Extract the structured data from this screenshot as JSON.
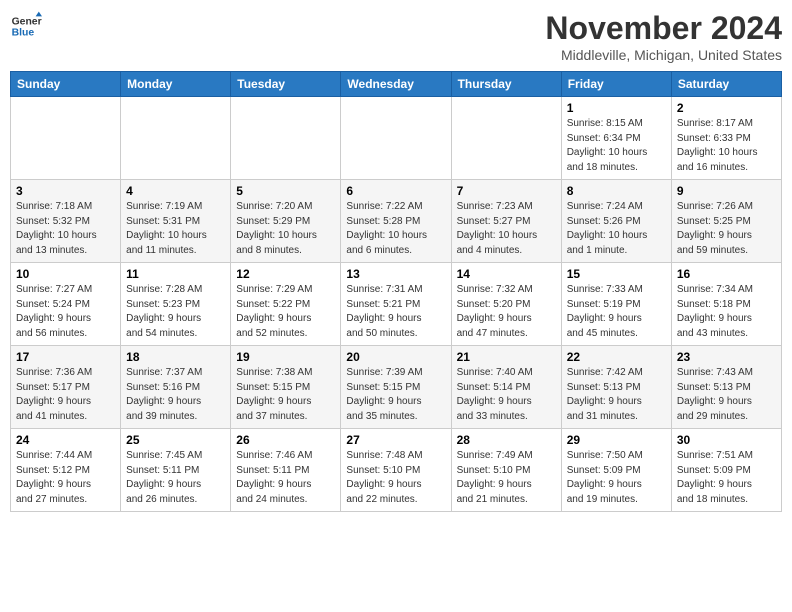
{
  "logo": {
    "line1": "General",
    "line2": "Blue"
  },
  "title": "November 2024",
  "location": "Middleville, Michigan, United States",
  "days_of_week": [
    "Sunday",
    "Monday",
    "Tuesday",
    "Wednesday",
    "Thursday",
    "Friday",
    "Saturday"
  ],
  "weeks": [
    [
      {
        "day": "",
        "info": ""
      },
      {
        "day": "",
        "info": ""
      },
      {
        "day": "",
        "info": ""
      },
      {
        "day": "",
        "info": ""
      },
      {
        "day": "",
        "info": ""
      },
      {
        "day": "1",
        "info": "Sunrise: 8:15 AM\nSunset: 6:34 PM\nDaylight: 10 hours\nand 18 minutes."
      },
      {
        "day": "2",
        "info": "Sunrise: 8:17 AM\nSunset: 6:33 PM\nDaylight: 10 hours\nand 16 minutes."
      }
    ],
    [
      {
        "day": "3",
        "info": "Sunrise: 7:18 AM\nSunset: 5:32 PM\nDaylight: 10 hours\nand 13 minutes."
      },
      {
        "day": "4",
        "info": "Sunrise: 7:19 AM\nSunset: 5:31 PM\nDaylight: 10 hours\nand 11 minutes."
      },
      {
        "day": "5",
        "info": "Sunrise: 7:20 AM\nSunset: 5:29 PM\nDaylight: 10 hours\nand 8 minutes."
      },
      {
        "day": "6",
        "info": "Sunrise: 7:22 AM\nSunset: 5:28 PM\nDaylight: 10 hours\nand 6 minutes."
      },
      {
        "day": "7",
        "info": "Sunrise: 7:23 AM\nSunset: 5:27 PM\nDaylight: 10 hours\nand 4 minutes."
      },
      {
        "day": "8",
        "info": "Sunrise: 7:24 AM\nSunset: 5:26 PM\nDaylight: 10 hours\nand 1 minute."
      },
      {
        "day": "9",
        "info": "Sunrise: 7:26 AM\nSunset: 5:25 PM\nDaylight: 9 hours\nand 59 minutes."
      }
    ],
    [
      {
        "day": "10",
        "info": "Sunrise: 7:27 AM\nSunset: 5:24 PM\nDaylight: 9 hours\nand 56 minutes."
      },
      {
        "day": "11",
        "info": "Sunrise: 7:28 AM\nSunset: 5:23 PM\nDaylight: 9 hours\nand 54 minutes."
      },
      {
        "day": "12",
        "info": "Sunrise: 7:29 AM\nSunset: 5:22 PM\nDaylight: 9 hours\nand 52 minutes."
      },
      {
        "day": "13",
        "info": "Sunrise: 7:31 AM\nSunset: 5:21 PM\nDaylight: 9 hours\nand 50 minutes."
      },
      {
        "day": "14",
        "info": "Sunrise: 7:32 AM\nSunset: 5:20 PM\nDaylight: 9 hours\nand 47 minutes."
      },
      {
        "day": "15",
        "info": "Sunrise: 7:33 AM\nSunset: 5:19 PM\nDaylight: 9 hours\nand 45 minutes."
      },
      {
        "day": "16",
        "info": "Sunrise: 7:34 AM\nSunset: 5:18 PM\nDaylight: 9 hours\nand 43 minutes."
      }
    ],
    [
      {
        "day": "17",
        "info": "Sunrise: 7:36 AM\nSunset: 5:17 PM\nDaylight: 9 hours\nand 41 minutes."
      },
      {
        "day": "18",
        "info": "Sunrise: 7:37 AM\nSunset: 5:16 PM\nDaylight: 9 hours\nand 39 minutes."
      },
      {
        "day": "19",
        "info": "Sunrise: 7:38 AM\nSunset: 5:15 PM\nDaylight: 9 hours\nand 37 minutes."
      },
      {
        "day": "20",
        "info": "Sunrise: 7:39 AM\nSunset: 5:15 PM\nDaylight: 9 hours\nand 35 minutes."
      },
      {
        "day": "21",
        "info": "Sunrise: 7:40 AM\nSunset: 5:14 PM\nDaylight: 9 hours\nand 33 minutes."
      },
      {
        "day": "22",
        "info": "Sunrise: 7:42 AM\nSunset: 5:13 PM\nDaylight: 9 hours\nand 31 minutes."
      },
      {
        "day": "23",
        "info": "Sunrise: 7:43 AM\nSunset: 5:13 PM\nDaylight: 9 hours\nand 29 minutes."
      }
    ],
    [
      {
        "day": "24",
        "info": "Sunrise: 7:44 AM\nSunset: 5:12 PM\nDaylight: 9 hours\nand 27 minutes."
      },
      {
        "day": "25",
        "info": "Sunrise: 7:45 AM\nSunset: 5:11 PM\nDaylight: 9 hours\nand 26 minutes."
      },
      {
        "day": "26",
        "info": "Sunrise: 7:46 AM\nSunset: 5:11 PM\nDaylight: 9 hours\nand 24 minutes."
      },
      {
        "day": "27",
        "info": "Sunrise: 7:48 AM\nSunset: 5:10 PM\nDaylight: 9 hours\nand 22 minutes."
      },
      {
        "day": "28",
        "info": "Sunrise: 7:49 AM\nSunset: 5:10 PM\nDaylight: 9 hours\nand 21 minutes."
      },
      {
        "day": "29",
        "info": "Sunrise: 7:50 AM\nSunset: 5:09 PM\nDaylight: 9 hours\nand 19 minutes."
      },
      {
        "day": "30",
        "info": "Sunrise: 7:51 AM\nSunset: 5:09 PM\nDaylight: 9 hours\nand 18 minutes."
      }
    ]
  ]
}
